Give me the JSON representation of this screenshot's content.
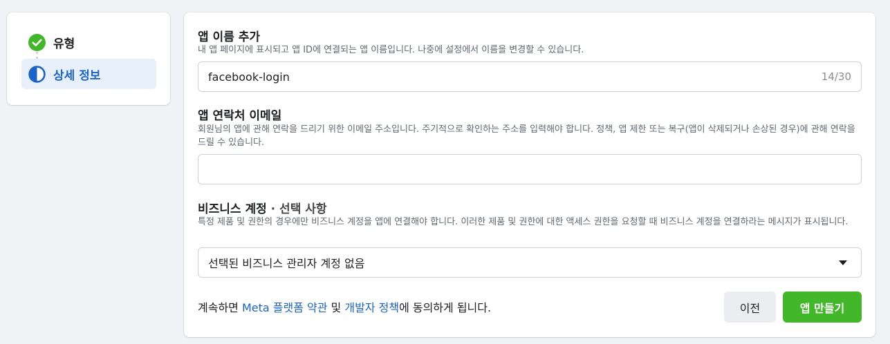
{
  "steps": [
    {
      "label": "유형",
      "state": "complete",
      "icon": "check-circle-icon"
    },
    {
      "label": "상세 정보",
      "state": "active",
      "icon": "half-circle-icon"
    }
  ],
  "colors": {
    "accent": "#1b63c6",
    "success": "#42b72a",
    "active_bg": "#e7f0fb"
  },
  "app_name": {
    "title": "앱 이름 추가",
    "description": "내 앱 페이지에 표시되고 앱 ID에 연결되는 앱 이름입니다. 나중에 설정에서 이름을 변경할 수 있습니다.",
    "value": "facebook-login",
    "counter": "14/30"
  },
  "contact_email": {
    "title": "앱 연락처 이메일",
    "description": "회원님의 앱에 관해 연락을 드리기 위한 이메일 주소입니다. 주기적으로 확인하는 주소를 입력해야 합니다. 정책, 앱 제한 또는 복구(앱이 삭제되거나 손상된 경우)에 관해 연락을 드릴 수 있습니다.",
    "value": ""
  },
  "business": {
    "title": "비즈니스 계정",
    "optional": " · 선택 사항",
    "description": "특정 제품 및 권한의 경우에만 비즈니스 계정을 앱에 연결해야 합니다. 이러한 제품 및 권한에 대한 액세스 권한을 요청할 때 비즈니스 계정을 연결하라는 메시지가 표시됩니다.",
    "selected": "선택된 비즈니스 관리자 계정 없음"
  },
  "footer": {
    "terms_prefix": "계속하면 ",
    "terms_link": "Meta 플랫폼 약관",
    "terms_and": " 및 ",
    "policy_link": "개발자 정책",
    "terms_suffix": "에 동의하게 됩니다.",
    "prev_label": "이전",
    "create_label": "앱 만들기"
  }
}
